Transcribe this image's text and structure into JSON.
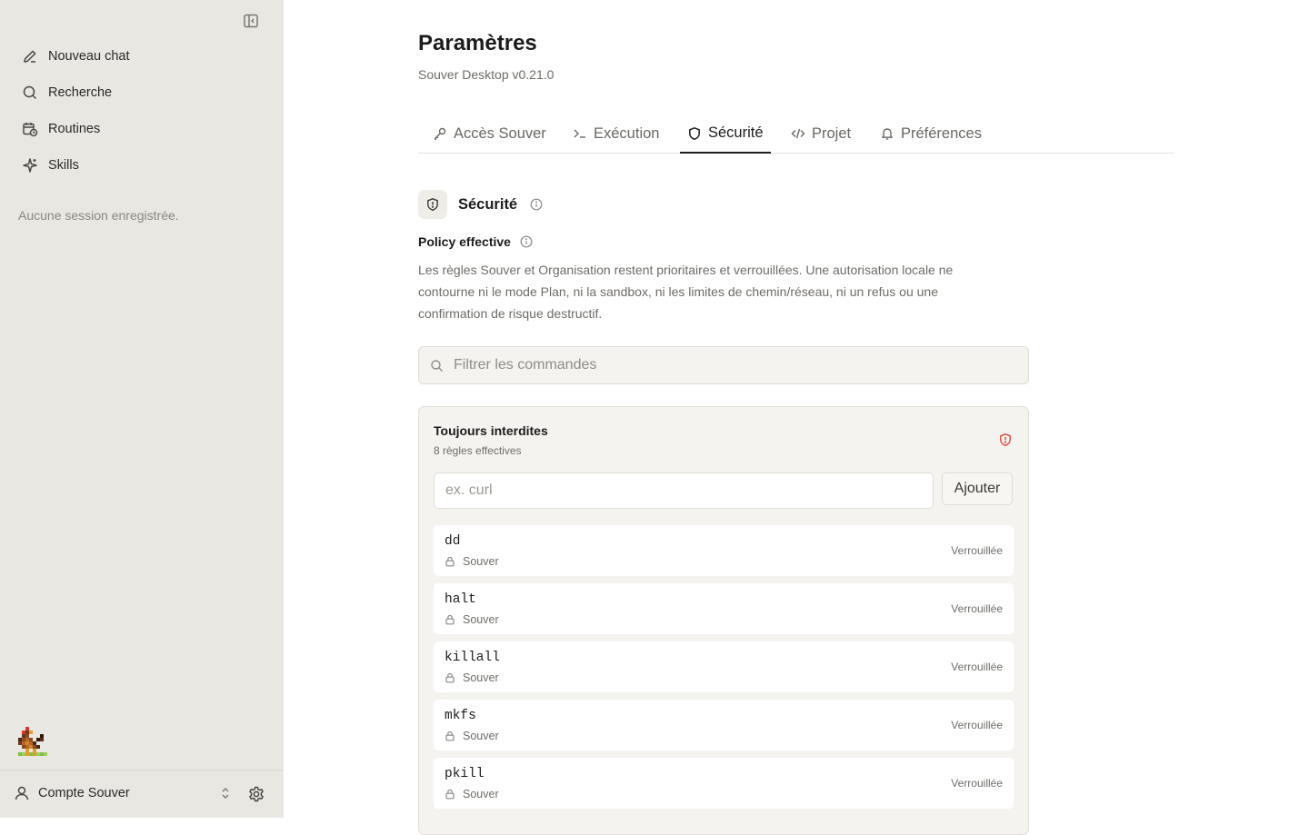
{
  "sidebar": {
    "items": [
      {
        "label": "Nouveau chat",
        "icon": "pencil-icon"
      },
      {
        "label": "Recherche",
        "icon": "search-icon"
      },
      {
        "label": "Routines",
        "icon": "calendar-clock-icon"
      },
      {
        "label": "Skills",
        "icon": "sparkle-icon"
      }
    ],
    "empty_text": "Aucune session enregistrée.",
    "account_label": "Compte Souver"
  },
  "header": {
    "title": "Paramètres",
    "subtitle": "Souver Desktop v0.21.0"
  },
  "tabs": [
    {
      "label": "Accès Souver",
      "icon": "key-icon",
      "active": false
    },
    {
      "label": "Exécution",
      "icon": "terminal-icon",
      "active": false
    },
    {
      "label": "Sécurité",
      "icon": "shield-icon",
      "active": true
    },
    {
      "label": "Projet",
      "icon": "code-icon",
      "active": false
    },
    {
      "label": "Préférences",
      "icon": "bell-icon",
      "active": false
    }
  ],
  "security": {
    "title": "Sécurité",
    "policy_title": "Policy effective",
    "policy_text": "Les règles Souver et Organisation restent prioritaires et verrouillées. Une autorisation locale ne contourne ni le mode Plan, ni la sandbox, ni les limites de chemin/réseau, ni un refus ou une confirmation de risque destructif.",
    "filter_placeholder": "Filtrer les commandes"
  },
  "forbidden": {
    "title": "Toujours interdites",
    "count": "8 règles effectives",
    "input_placeholder": "ex. curl",
    "add_label": "Ajouter",
    "rules": [
      {
        "command": "dd",
        "source": "Souver",
        "state": "Verrouillée"
      },
      {
        "command": "halt",
        "source": "Souver",
        "state": "Verrouillée"
      },
      {
        "command": "killall",
        "source": "Souver",
        "state": "Verrouillée"
      },
      {
        "command": "mkfs",
        "source": "Souver",
        "state": "Verrouillée"
      },
      {
        "command": "pkill",
        "source": "Souver",
        "state": "Verrouillée"
      }
    ]
  },
  "colors": {
    "sidebar_bg": "#e9e7e2",
    "alert": "#d9473b",
    "text_muted": "#6f6d68"
  }
}
